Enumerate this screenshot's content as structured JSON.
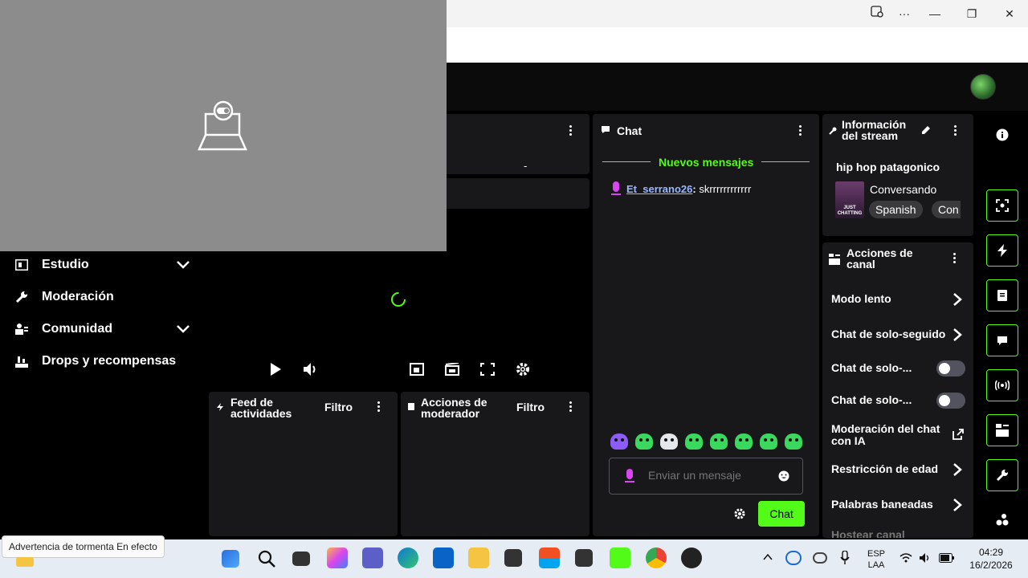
{
  "sidebar": {
    "items": [
      {
        "label": "Estudio",
        "icon": "studio-icon",
        "expandable": true
      },
      {
        "label": "Moderación",
        "icon": "wrench-icon",
        "expandable": false
      },
      {
        "label": "Comunidad",
        "icon": "community-icon",
        "expandable": true
      },
      {
        "label": "Drops y recompensas",
        "icon": "drops-icon",
        "expandable": false
      }
    ]
  },
  "video_panel": {
    "top_panel_dash": "-"
  },
  "feed": {
    "title": "Feed de actividades",
    "filter": "Filtro"
  },
  "mod_actions": {
    "title": "Acciones de moderador",
    "filter": "Filtro"
  },
  "chat": {
    "title": "Chat",
    "new_messages": "Nuevos mensajes",
    "messages": [
      {
        "user": "Et_serrano26",
        "text": "skrrrrrrrrrrrr"
      }
    ],
    "placeholder": "Enviar un mensaje",
    "send_label": "Chat"
  },
  "stream_info": {
    "title": "Información del stream",
    "stream_title": "hip hop patagonico",
    "category": "Conversando",
    "thumb_text": "JUST CHATTING",
    "tags": [
      "Spanish",
      "Con"
    ]
  },
  "channel_actions": {
    "title": "Acciones de canal",
    "items": [
      {
        "label": "Modo lento",
        "control": "arrow"
      },
      {
        "label": "Chat de solo-seguido",
        "control": "arrow"
      },
      {
        "label": "Chat de solo-...",
        "control": "toggle",
        "on": false
      },
      {
        "label": "Chat de solo-...",
        "control": "toggle",
        "on": false
      },
      {
        "label": "Moderación del chat con IA",
        "control": "external"
      },
      {
        "label": "Restricción de edad",
        "control": "arrow"
      },
      {
        "label": "Palabras baneadas",
        "control": "arrow"
      },
      {
        "label": "Hostear canal",
        "control": "none"
      }
    ]
  },
  "taskbar": {
    "tooltip": "Advertencia de tormenta En efecto",
    "lang_top": "ESP",
    "lang_bottom": "LAA",
    "time": "04:29",
    "date": "16/2/2026"
  },
  "colors": {
    "accent": "#53fc18",
    "panel": "#18181b",
    "purple": "#d946ef"
  }
}
